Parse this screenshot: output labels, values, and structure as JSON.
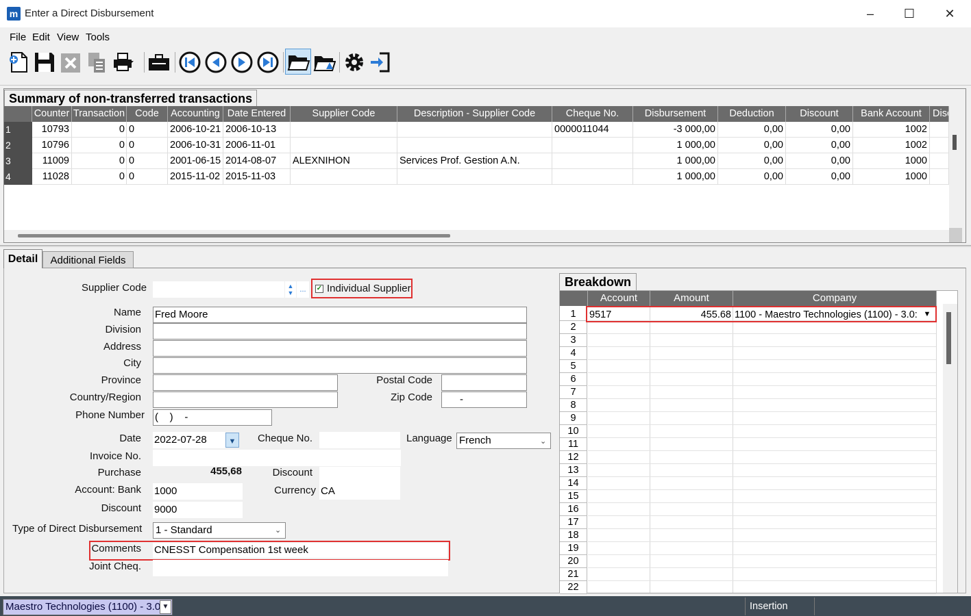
{
  "window": {
    "title": "Enter a Direct Disbursement",
    "minimize": "–",
    "maximize": "☐",
    "close": "✕",
    "logo": "m"
  },
  "menu": [
    "File",
    "Edit",
    "View",
    "Tools"
  ],
  "toolbar_icons": [
    "new-icon",
    "save-icon",
    "delete-icon",
    "copy-icon",
    "print-icon",
    "briefcase-icon",
    "first-record-icon",
    "previous-record-icon",
    "next-record-icon",
    "last-record-icon",
    "open-folder-icon",
    "search-folder-icon",
    "settings-gear-icon",
    "exit-icon"
  ],
  "summary": {
    "tab_label": "Summary of non-transferred transactions",
    "columns": [
      "Counter",
      "Transaction",
      "Code",
      "Accounting",
      "Date Entered",
      "Supplier Code",
      "Description - Supplier Code",
      "Cheque No.",
      "Disbursement",
      "Deduction",
      "Discount",
      "Bank Account",
      "Disco"
    ],
    "rows": [
      {
        "num": "1",
        "counter": "10793",
        "transaction": "0",
        "code": "0",
        "accounting": "2006-10-21",
        "date_entered": "2006-10-13",
        "supplier_code": "",
        "description": "",
        "cheque": "0000011044",
        "disbursement": "-3 000,00",
        "deduction": "0,00",
        "discount": "0,00",
        "bank": "1002"
      },
      {
        "num": "2",
        "counter": "10796",
        "transaction": "0",
        "code": "0",
        "accounting": "2006-10-31",
        "date_entered": "2006-11-01",
        "supplier_code": "",
        "description": "",
        "cheque": "",
        "disbursement": "1 000,00",
        "deduction": "0,00",
        "discount": "0,00",
        "bank": "1002"
      },
      {
        "num": "3",
        "counter": "11009",
        "transaction": "0",
        "code": "0",
        "accounting": "2001-06-15",
        "date_entered": "2014-08-07",
        "supplier_code": "ALEXNIHON",
        "description": "Services Prof. Gestion A.N.",
        "cheque": "",
        "disbursement": "1 000,00",
        "deduction": "0,00",
        "discount": "0,00",
        "bank": "1000"
      },
      {
        "num": "4",
        "counter": "11028",
        "transaction": "0",
        "code": "0",
        "accounting": "2015-11-02",
        "date_entered": "2015-11-03",
        "supplier_code": "",
        "description": "",
        "cheque": "",
        "disbursement": "1 000,00",
        "deduction": "0,00",
        "discount": "0,00",
        "bank": "1000"
      }
    ]
  },
  "tabs": {
    "detail": "Detail",
    "additional": "Additional Fields"
  },
  "form": {
    "supplier_code_label": "Supplier Code",
    "supplier_code_value": "",
    "ellipsis": "...",
    "individual_supplier_label": "Individual Supplier",
    "individual_supplier_checked": true,
    "check_mark": "✓",
    "name_label": "Name",
    "name_value": "Fred Moore",
    "division_label": "Division",
    "division_value": "",
    "address_label": "Address",
    "address_value": "",
    "city_label": "City",
    "city_value": "",
    "province_label": "Province",
    "province_value": "",
    "postal_code_label": "Postal Code",
    "postal_code_value": "",
    "country_label": "Country/Region",
    "country_value": "",
    "zip_code_label": "Zip Code",
    "zip_code_value": "-",
    "phone_label": "Phone Number",
    "phone_value": "(    )    -",
    "date_label": "Date",
    "date_value": "2022-07-28",
    "cheque_label": "Cheque No.",
    "cheque_value": "",
    "language_label": "Language",
    "language_value": "French",
    "invoice_label": "Invoice No.",
    "invoice_value": "",
    "purchase_label": "Purchase",
    "purchase_value": "455,68",
    "discount_label": "Discount",
    "discount_value": "",
    "account_bank_label": "Account: Bank",
    "account_bank_value": "1000",
    "currency_label": "Currency",
    "currency_value": "CA",
    "discount_account_label": "Discount",
    "discount_account_value": "9000",
    "type_label": "Type of Direct Disbursement",
    "type_value": "1 - Standard",
    "comments_label": "Comments",
    "comments_value": "CNESST Compensation 1st week",
    "joint_cheq_label": "Joint Cheq.",
    "joint_cheq_value": ""
  },
  "breakdown": {
    "tab_label": "Breakdown",
    "columns": [
      "Account",
      "Amount",
      "Company"
    ],
    "row1": {
      "account": "9517",
      "amount": "455.68",
      "company": "1100 - Maestro Technologies (1100) - 3.0:"
    },
    "row_numbers": [
      "1",
      "2",
      "3",
      "4",
      "5",
      "6",
      "7",
      "8",
      "9",
      "10",
      "11",
      "12",
      "13",
      "14",
      "15",
      "16",
      "17",
      "18",
      "19",
      "20",
      "21",
      "22"
    ]
  },
  "status": {
    "company": "Maestro Technologies (1100) - 3.0",
    "mode": "Insertion"
  }
}
